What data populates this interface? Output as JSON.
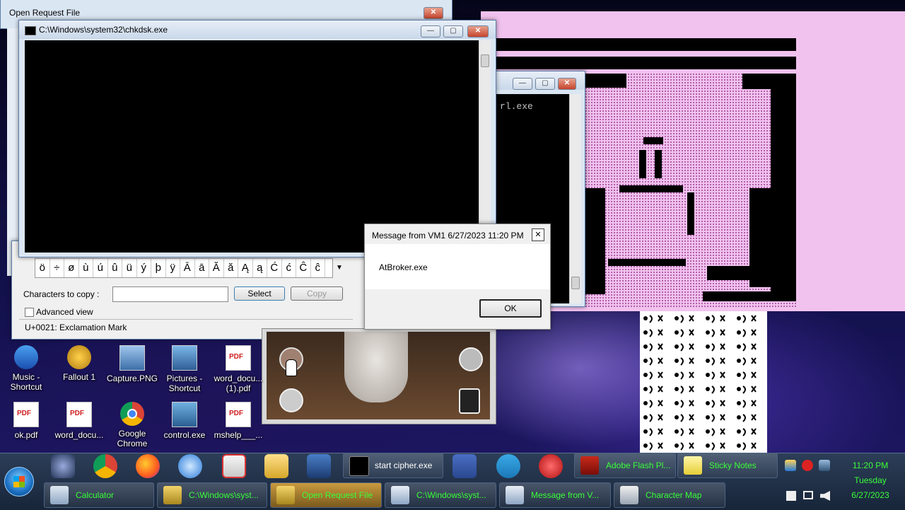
{
  "desktop_icons": [
    {
      "label": "Music -\nShortcut"
    },
    {
      "label": "Fallout 1"
    },
    {
      "label": "Capture.PNG"
    },
    {
      "label": "Pictures -\nShortcut"
    },
    {
      "label": "word_docu...\n(1).pdf"
    },
    {
      "label": "ok.pdf"
    },
    {
      "label": "word_docu..."
    },
    {
      "label": "Google\nChrome"
    },
    {
      "label": "control.exe"
    },
    {
      "label": "mshelp___..."
    }
  ],
  "open_request": {
    "title": "Open Request File",
    "close": "✕"
  },
  "chkdsk": {
    "title": "C:\\Windows\\system32\\chkdsk.exe",
    "min": "—",
    "max": "▢",
    "close": "✕"
  },
  "ctrl_console": {
    "text": "rl.exe",
    "min": "—",
    "max": "▢",
    "close": "✕"
  },
  "charmap": {
    "chars": [
      "ö",
      "÷",
      "ø",
      "ù",
      "ú",
      "û",
      "ü",
      "ý",
      "þ",
      "ÿ",
      "Ā",
      "ā",
      "Ă",
      "ă",
      "Ą",
      "ą",
      "Ć",
      "ć",
      "Ĉ",
      "ĉ"
    ],
    "copy_label": "Characters to copy :",
    "copy_value": "",
    "select_label": "Select",
    "copy_button": "Copy",
    "advanced_label": "Advanced view",
    "status": "U+0021: Exclamation Mark"
  },
  "message": {
    "title": "Message from VM1 6/27/2023 11:20 PM",
    "close": "✕",
    "body": "AtBroker.exe",
    "ok": "OK"
  },
  "taskbar": {
    "row1": [
      {
        "label": "start  cipher.exe"
      },
      {
        "label": "Adobe Flash Pl..."
      },
      {
        "label": "Sticky Notes"
      }
    ],
    "row2": [
      {
        "label": "Calculator"
      },
      {
        "label": "C:\\Windows\\syst..."
      },
      {
        "label": "Open Request File"
      },
      {
        "label": "C:\\Windows\\syst..."
      },
      {
        "label": "Message from V..."
      },
      {
        "label": "Character Map"
      }
    ],
    "clock": {
      "time": "11:20 PM",
      "day": "Tuesday",
      "date": "6/27/2023"
    }
  },
  "colors": {
    "green_text": "#3aff3a",
    "pink": "#f2b8f0",
    "accent_gold": "#c89a3e"
  }
}
